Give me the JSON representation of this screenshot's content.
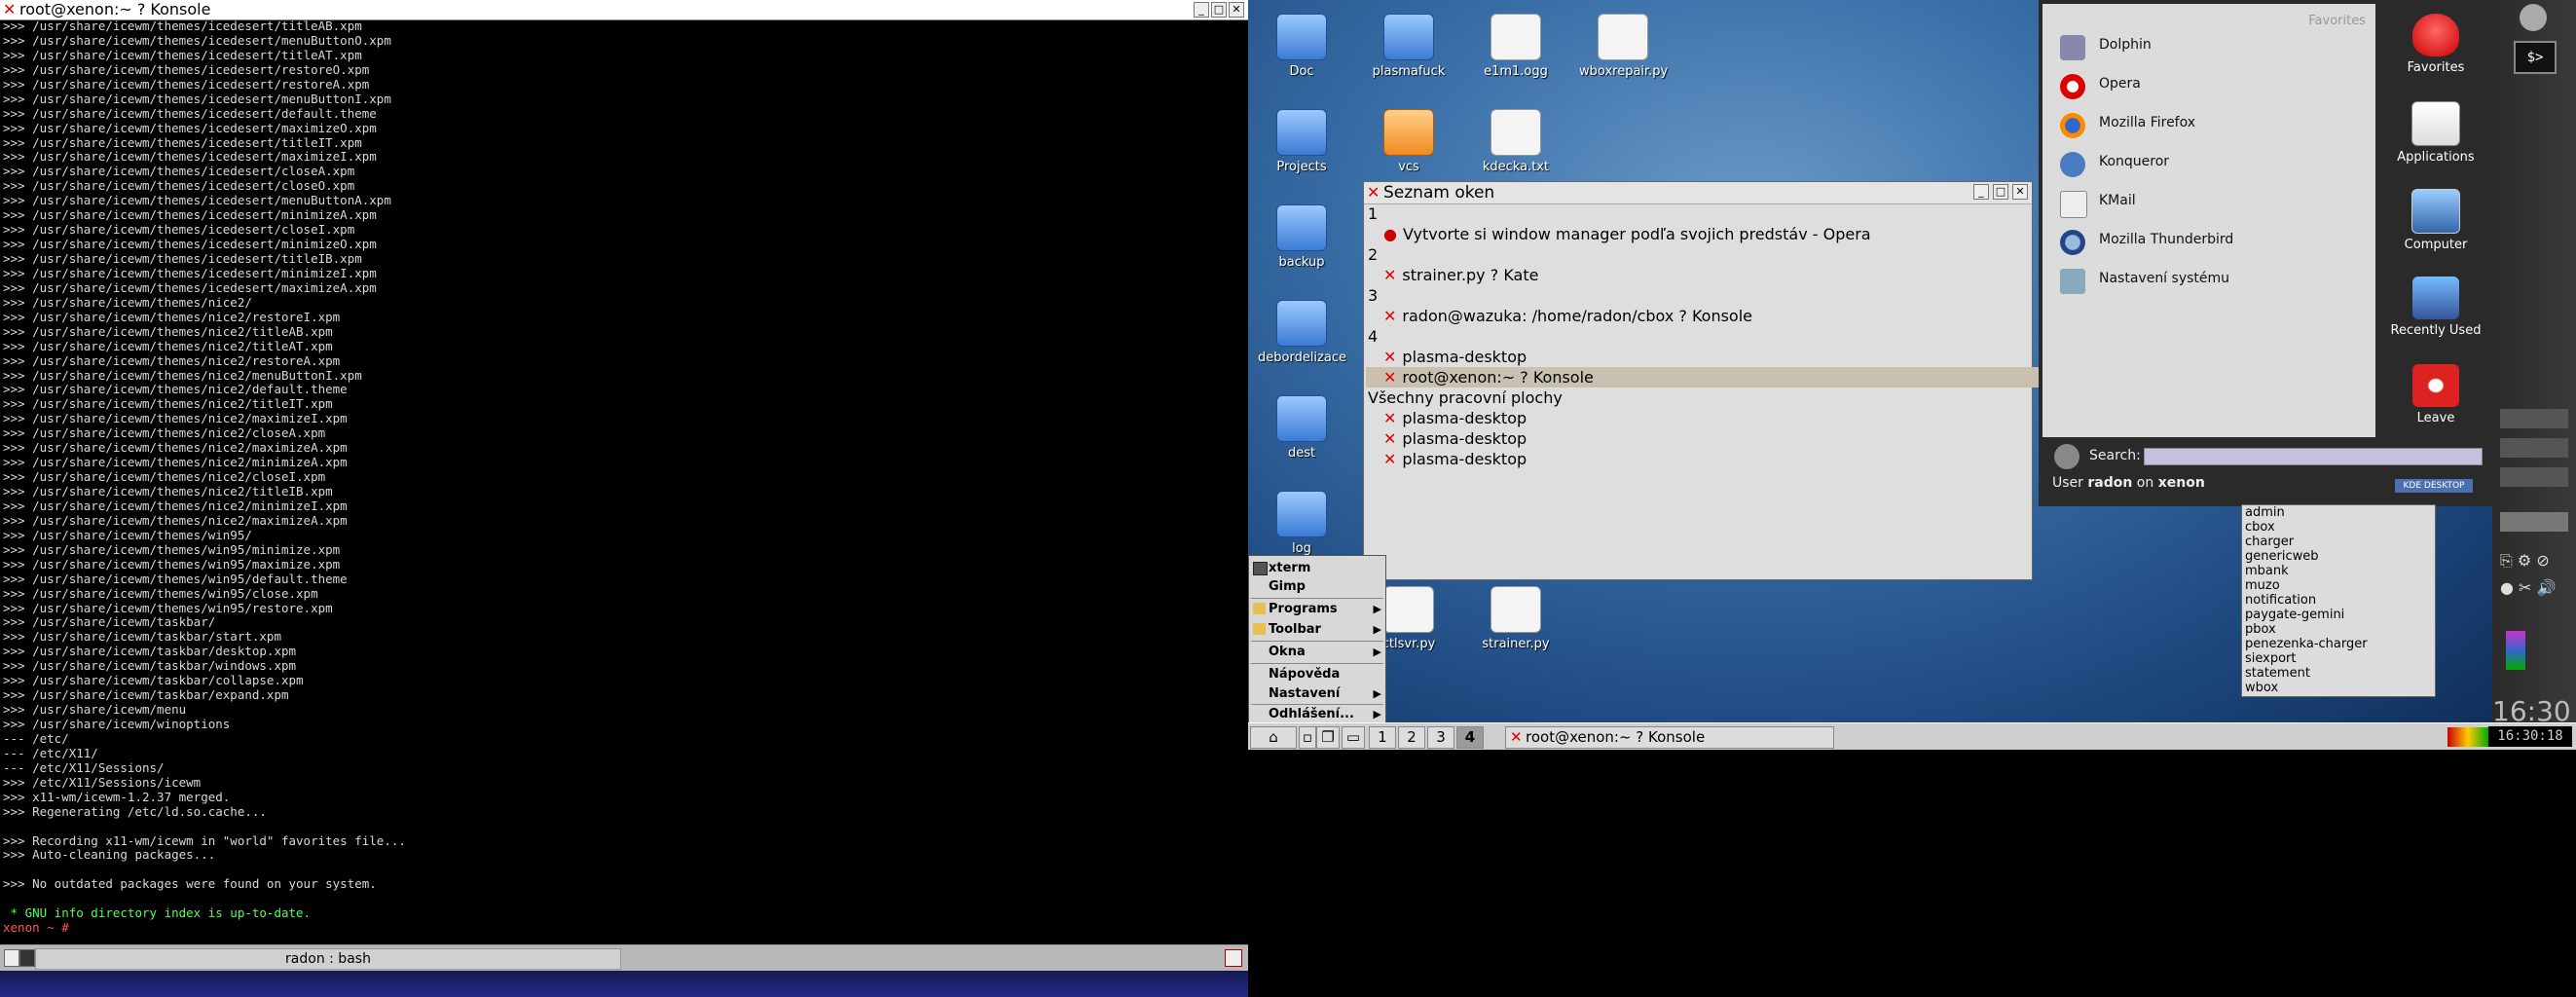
{
  "konsole": {
    "title": "root@xenon:~ ? Konsole",
    "tab_label": "radon : bash",
    "lines": [
      {
        "t": ">>> /usr/share/icewm/themes/icedesert/titleAB.xpm",
        "c": ""
      },
      {
        "t": ">>> /usr/share/icewm/themes/icedesert/menuButtonO.xpm",
        "c": ""
      },
      {
        "t": ">>> /usr/share/icewm/themes/icedesert/titleAT.xpm",
        "c": ""
      },
      {
        "t": ">>> /usr/share/icewm/themes/icedesert/restoreO.xpm",
        "c": ""
      },
      {
        "t": ">>> /usr/share/icewm/themes/icedesert/restoreA.xpm",
        "c": ""
      },
      {
        "t": ">>> /usr/share/icewm/themes/icedesert/menuButtonI.xpm",
        "c": ""
      },
      {
        "t": ">>> /usr/share/icewm/themes/icedesert/default.theme",
        "c": ""
      },
      {
        "t": ">>> /usr/share/icewm/themes/icedesert/maximizeO.xpm",
        "c": ""
      },
      {
        "t": ">>> /usr/share/icewm/themes/icedesert/titleIT.xpm",
        "c": ""
      },
      {
        "t": ">>> /usr/share/icewm/themes/icedesert/maximizeI.xpm",
        "c": ""
      },
      {
        "t": ">>> /usr/share/icewm/themes/icedesert/closeA.xpm",
        "c": ""
      },
      {
        "t": ">>> /usr/share/icewm/themes/icedesert/closeO.xpm",
        "c": ""
      },
      {
        "t": ">>> /usr/share/icewm/themes/icedesert/menuButtonA.xpm",
        "c": ""
      },
      {
        "t": ">>> /usr/share/icewm/themes/icedesert/minimizeA.xpm",
        "c": ""
      },
      {
        "t": ">>> /usr/share/icewm/themes/icedesert/closeI.xpm",
        "c": ""
      },
      {
        "t": ">>> /usr/share/icewm/themes/icedesert/minimizeO.xpm",
        "c": ""
      },
      {
        "t": ">>> /usr/share/icewm/themes/icedesert/titleIB.xpm",
        "c": ""
      },
      {
        "t": ">>> /usr/share/icewm/themes/icedesert/minimizeI.xpm",
        "c": ""
      },
      {
        "t": ">>> /usr/share/icewm/themes/icedesert/maximizeA.xpm",
        "c": ""
      },
      {
        "t": ">>> /usr/share/icewm/themes/nice2/",
        "c": ""
      },
      {
        "t": ">>> /usr/share/icewm/themes/nice2/restoreI.xpm",
        "c": ""
      },
      {
        "t": ">>> /usr/share/icewm/themes/nice2/titleAB.xpm",
        "c": ""
      },
      {
        "t": ">>> /usr/share/icewm/themes/nice2/titleAT.xpm",
        "c": ""
      },
      {
        "t": ">>> /usr/share/icewm/themes/nice2/restoreA.xpm",
        "c": ""
      },
      {
        "t": ">>> /usr/share/icewm/themes/nice2/menuButtonI.xpm",
        "c": ""
      },
      {
        "t": ">>> /usr/share/icewm/themes/nice2/default.theme",
        "c": ""
      },
      {
        "t": ">>> /usr/share/icewm/themes/nice2/titleIT.xpm",
        "c": ""
      },
      {
        "t": ">>> /usr/share/icewm/themes/nice2/maximizeI.xpm",
        "c": ""
      },
      {
        "t": ">>> /usr/share/icewm/themes/nice2/closeA.xpm",
        "c": ""
      },
      {
        "t": ">>> /usr/share/icewm/themes/nice2/maximizeA.xpm",
        "c": ""
      },
      {
        "t": ">>> /usr/share/icewm/themes/nice2/minimizeA.xpm",
        "c": ""
      },
      {
        "t": ">>> /usr/share/icewm/themes/nice2/closeI.xpm",
        "c": ""
      },
      {
        "t": ">>> /usr/share/icewm/themes/nice2/titleIB.xpm",
        "c": ""
      },
      {
        "t": ">>> /usr/share/icewm/themes/nice2/minimizeI.xpm",
        "c": ""
      },
      {
        "t": ">>> /usr/share/icewm/themes/nice2/maximizeA.xpm",
        "c": ""
      },
      {
        "t": ">>> /usr/share/icewm/themes/win95/",
        "c": ""
      },
      {
        "t": ">>> /usr/share/icewm/themes/win95/minimize.xpm",
        "c": ""
      },
      {
        "t": ">>> /usr/share/icewm/themes/win95/maximize.xpm",
        "c": ""
      },
      {
        "t": ">>> /usr/share/icewm/themes/win95/default.theme",
        "c": ""
      },
      {
        "t": ">>> /usr/share/icewm/themes/win95/close.xpm",
        "c": ""
      },
      {
        "t": ">>> /usr/share/icewm/themes/win95/restore.xpm",
        "c": ""
      },
      {
        "t": ">>> /usr/share/icewm/taskbar/",
        "c": ""
      },
      {
        "t": ">>> /usr/share/icewm/taskbar/start.xpm",
        "c": ""
      },
      {
        "t": ">>> /usr/share/icewm/taskbar/desktop.xpm",
        "c": ""
      },
      {
        "t": ">>> /usr/share/icewm/taskbar/windows.xpm",
        "c": ""
      },
      {
        "t": ">>> /usr/share/icewm/taskbar/collapse.xpm",
        "c": ""
      },
      {
        "t": ">>> /usr/share/icewm/taskbar/expand.xpm",
        "c": ""
      },
      {
        "t": ">>> /usr/share/icewm/menu",
        "c": ""
      },
      {
        "t": ">>> /usr/share/icewm/winoptions",
        "c": ""
      },
      {
        "t": "--- /etc/",
        "c": ""
      },
      {
        "t": "--- /etc/X11/",
        "c": ""
      },
      {
        "t": "--- /etc/X11/Sessions/",
        "c": ""
      },
      {
        "t": ">>> /etc/X11/Sessions/icewm",
        "c": ""
      },
      {
        "t": ">>> x11-wm/icewm-1.2.37 merged.",
        "c": ""
      },
      {
        "t": ">>> Regenerating /etc/ld.so.cache...",
        "c": ""
      },
      {
        "t": "",
        "c": ""
      },
      {
        "t": ">>> Recording x11-wm/icewm in \"world\" favorites file...",
        "c": ""
      },
      {
        "t": ">>> Auto-cleaning packages...",
        "c": ""
      },
      {
        "t": "",
        "c": ""
      },
      {
        "t": ">>> No outdated packages were found on your system.",
        "c": ""
      },
      {
        "t": "",
        "c": ""
      },
      {
        "t": " * GNU info directory index is up-to-date.",
        "c": "g"
      },
      {
        "t": "xenon ~ #",
        "c": "p"
      }
    ]
  },
  "desktop_icons": [
    {
      "label": "Doc",
      "kind": "folder"
    },
    {
      "label": "plasmafuck",
      "kind": "folder"
    },
    {
      "label": "e1m1.ogg",
      "kind": "file"
    },
    {
      "label": "wboxrepair.py",
      "kind": "file"
    },
    {
      "label": "Projects",
      "kind": "folder"
    },
    {
      "label": "vcs",
      "kind": "folder-o"
    },
    {
      "label": "kdecka.txt",
      "kind": "file"
    },
    {
      "label": "backup",
      "kind": "folder"
    },
    {
      "label": "debordelizace",
      "kind": "folder"
    },
    {
      "label": "dest",
      "kind": "folder"
    },
    {
      "label": "log",
      "kind": "folder"
    },
    {
      "label": "ctlsvr.py",
      "kind": "file"
    },
    {
      "label": "strainer.py",
      "kind": "file"
    }
  ],
  "window_list": {
    "title": "Seznam oken",
    "desk1": "1",
    "desk1_item": "Vytvorte si window manager podľa svojich predstáv - Opera",
    "desk2": "2",
    "desk2_item": "strainer.py ? Kate",
    "desk3": "3",
    "desk3_item": "radon@wazuka: /home/radon/cbox ? Konsole",
    "desk4": "4",
    "desk4_item1": "plasma-desktop",
    "desk4_item2": "root@xenon:~ ? Konsole",
    "all_label": "Všechny pracovní plochy",
    "all_item1": "plasma-desktop",
    "all_item2": "plasma-desktop",
    "all_item3": "plasma-desktop"
  },
  "start_menu": {
    "items": [
      "xterm",
      "Gimp",
      "Programs",
      "Toolbar",
      "Okna",
      "Nápověda",
      "Nastavení",
      "Odhlášení..."
    ]
  },
  "taskbar": {
    "workspaces": [
      "1",
      "2",
      "3",
      "4"
    ],
    "active_task": "root@xenon:~ ? Konsole",
    "clock": "16:30:18"
  },
  "kickoff": {
    "favorites_header": "Favorites",
    "favorites": [
      "Dolphin",
      "Opera",
      "Mozilla Firefox",
      "Konqueror",
      "KMail",
      "Mozilla Thunderbird",
      "Nastavení systému"
    ],
    "tabs": [
      "Favorites",
      "Applications",
      "Computer",
      "Recently Used",
      "Leave"
    ],
    "search_label": "Search:",
    "user_prefix": "User",
    "user_name": "radon",
    "user_on": "on",
    "host_name": "xenon",
    "kde_badge": "KDE DESKTOP"
  },
  "cbox_popup": {
    "items": [
      "admin",
      "cbox",
      "charger",
      "genericweb",
      "mbank",
      "muzo",
      "notification",
      "paygate-gemini",
      "pbox",
      "penezenka-charger",
      "siexport",
      "statement",
      "wbox"
    ]
  },
  "panel": {
    "big_time": "16:30"
  }
}
